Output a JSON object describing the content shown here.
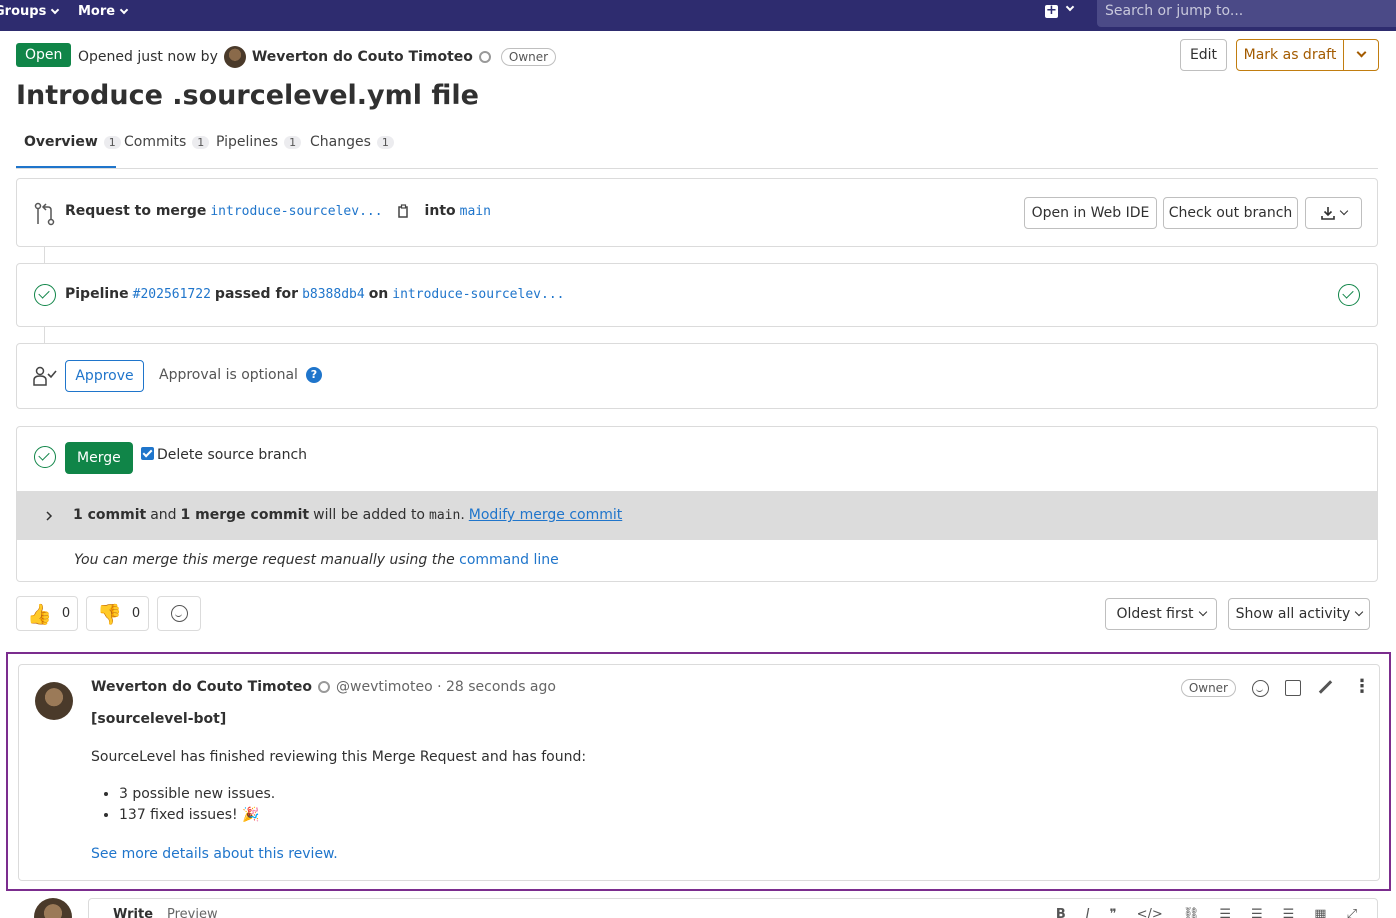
{
  "navbar": {
    "groups": "Groups",
    "more": "More",
    "search_placeholder": "Search or jump to..."
  },
  "header": {
    "status": "Open",
    "opened_text": "Opened just now by",
    "author": "Weverton do Couto Timoteo",
    "role": "Owner",
    "edit": "Edit",
    "mark_draft": "Mark as draft",
    "title": "Introduce .sourcelevel.yml file"
  },
  "tabs": [
    {
      "label": "Overview",
      "count": "1"
    },
    {
      "label": "Commits",
      "count": "1"
    },
    {
      "label": "Pipelines",
      "count": "1"
    },
    {
      "label": "Changes",
      "count": "1"
    }
  ],
  "merge_request": {
    "request_to_merge": "Request to merge",
    "source_branch": "introduce-sourcelev...",
    "into": "into",
    "target_branch": "main",
    "open_web_ide": "Open in Web IDE",
    "check_out": "Check out branch"
  },
  "pipeline": {
    "label": "Pipeline",
    "id": "#202561722",
    "passed_for": "passed for",
    "commit": "b8388db4",
    "on": "on",
    "branch": "introduce-sourcelev..."
  },
  "approval": {
    "approve": "Approve",
    "optional": "Approval is optional",
    "help": "?"
  },
  "merge": {
    "merge_button": "Merge",
    "delete_source": "Delete source branch",
    "commit_count": "1 commit",
    "and": "and",
    "merge_commit": "1 merge commit",
    "added_to": "will be added to",
    "target": "main",
    "period": ".",
    "modify": "Modify merge commit",
    "manual_text": "You can merge this merge request manually using the",
    "command_line": "command line"
  },
  "reactions": {
    "thumbs_up": "👍",
    "up_count": "0",
    "thumbs_down": "👎",
    "down_count": "0",
    "oldest_first": "Oldest first",
    "show_all": "Show all activity"
  },
  "note": {
    "author": "Weverton do Couto Timoteo",
    "handle": "@wevtimoteo · 28 seconds ago",
    "role": "Owner",
    "bot_tag": "[sourcelevel-bot]",
    "intro": "SourceLevel has finished reviewing this Merge Request and has found:",
    "items": [
      "3 possible new issues.",
      "137 fixed issues! 🎉"
    ],
    "details_link": "See more details about this review."
  },
  "editor": {
    "write": "Write",
    "preview": "Preview"
  },
  "icons": {
    "merge": "merge-request-icon",
    "copy": "copy-icon",
    "download": "download-icon",
    "approval": "approval-icon"
  }
}
